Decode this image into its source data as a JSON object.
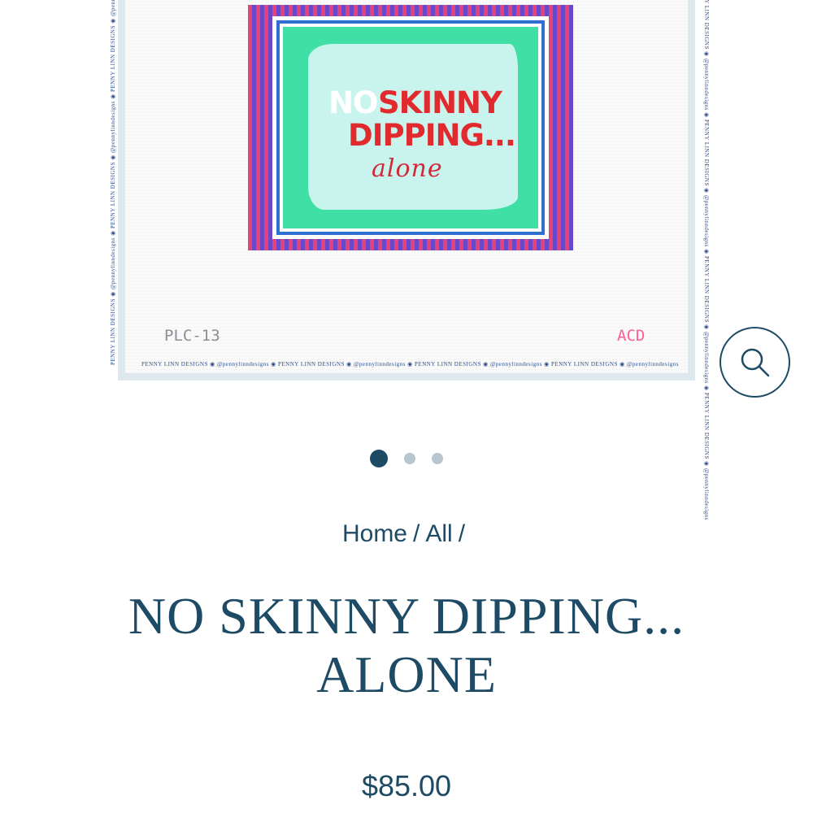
{
  "product_image": {
    "stitched_line1_white": "NO",
    "stitched_line1_red": "SKINNY",
    "stitched_line2": "DIPPING...",
    "stitched_line3": "alone",
    "code_left": "PLC-13",
    "code_right": "ACD",
    "selvedge_text": "PENNY LINN DESIGNS ◉ @pennylinndesigns ◉ PENNY LINN DESIGNS ◉ @pennylinndesigns ◉ PENNY LINN DESIGNS ◉ @pennylinndesigns ◉ PENNY LINN DESIGNS ◉ @pennylinndesigns"
  },
  "zoom_button": {
    "icon": "search-icon"
  },
  "carousel": {
    "dot_count": 3,
    "active_index": 0
  },
  "breadcrumb": {
    "home": "Home",
    "all": "All",
    "separator": "/"
  },
  "product": {
    "title_line1": "NO SKINNY DIPPING...",
    "title_line2": "ALONE",
    "price": "$85.00"
  },
  "colors": {
    "primary": "#1d4a64",
    "dot_inactive": "#b7c6cf",
    "stitch_red": "#e02a2e",
    "stitch_green": "#3fdfa6",
    "stitch_pink": "#e0457a",
    "stitch_purple": "#6a48c9"
  }
}
